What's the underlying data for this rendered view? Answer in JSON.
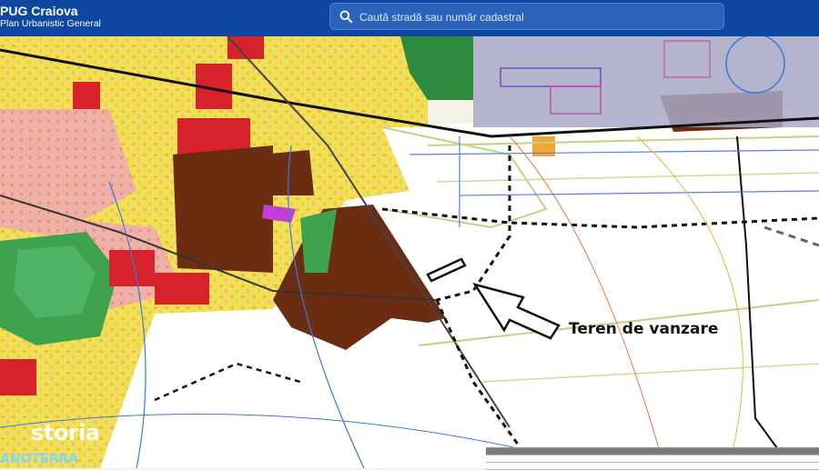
{
  "app": {
    "title": "PUG Craiova",
    "subtitle": "Plan Urbanistic General"
  },
  "search": {
    "placeholder": "Caută stradă sau număr cadastral"
  },
  "map": {
    "callout_label": "Teren de vanzare",
    "watermark": "storia",
    "watermark_sub": "ANOTERRA"
  },
  "colors": {
    "topbar": "#0d47a1",
    "residential": "#f2df55",
    "industrial": "#6b2d12",
    "commercial": "#d8222b",
    "green": "#3fa34d",
    "airport_zone": "#a9a9c8"
  }
}
